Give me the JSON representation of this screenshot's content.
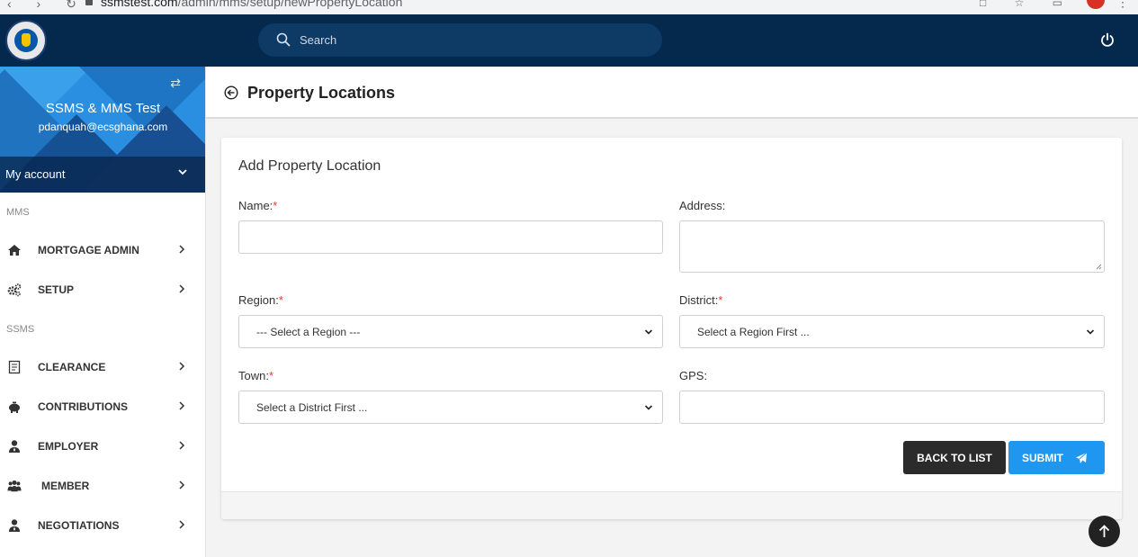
{
  "browser": {
    "url_host": "ssmstest.com",
    "url_path": "/admin/mms/setup/newPropertyLocation"
  },
  "topbar": {
    "search_placeholder": "Search"
  },
  "sidebar": {
    "user_name": "SSMS & MMS Test",
    "user_email": "pdanquah@ecsghana.com",
    "account_label": "My account",
    "sections": [
      {
        "title": "MMS",
        "items": [
          {
            "label": "MORTGAGE ADMIN",
            "icon": "home-icon"
          },
          {
            "label": "SETUP",
            "icon": "cogs-icon"
          }
        ]
      },
      {
        "title": "SSMS",
        "items": [
          {
            "label": "CLEARANCE",
            "icon": "clipboard-icon"
          },
          {
            "label": "CONTRIBUTIONS",
            "icon": "piggy-bank-icon"
          },
          {
            "label": "EMPLOYER",
            "icon": "user-tie-icon"
          },
          {
            "label": "MEMBER",
            "icon": "users-icon"
          },
          {
            "label": "NEGOTIATIONS",
            "icon": "user-tie-icon"
          }
        ]
      }
    ]
  },
  "page": {
    "title": "Property Locations"
  },
  "form": {
    "title": "Add Property Location",
    "name_label": "Name:",
    "name_value": "",
    "address_label": "Address:",
    "address_value": "",
    "region_label": "Region:",
    "region_selected": "--- Select a Region ---",
    "district_label": "District:",
    "district_selected": "Select a Region First ...",
    "town_label": "Town:",
    "town_selected": "Select a District First ...",
    "gps_label": "GPS:",
    "gps_value": "",
    "required_mark": "*",
    "back_button": "BACK TO LIST",
    "submit_button": "SUBMIT"
  },
  "colors": {
    "navbar": "#05284d",
    "primary": "#1f97f0",
    "dark_button": "#2b2b2b",
    "required": "#e53935"
  }
}
